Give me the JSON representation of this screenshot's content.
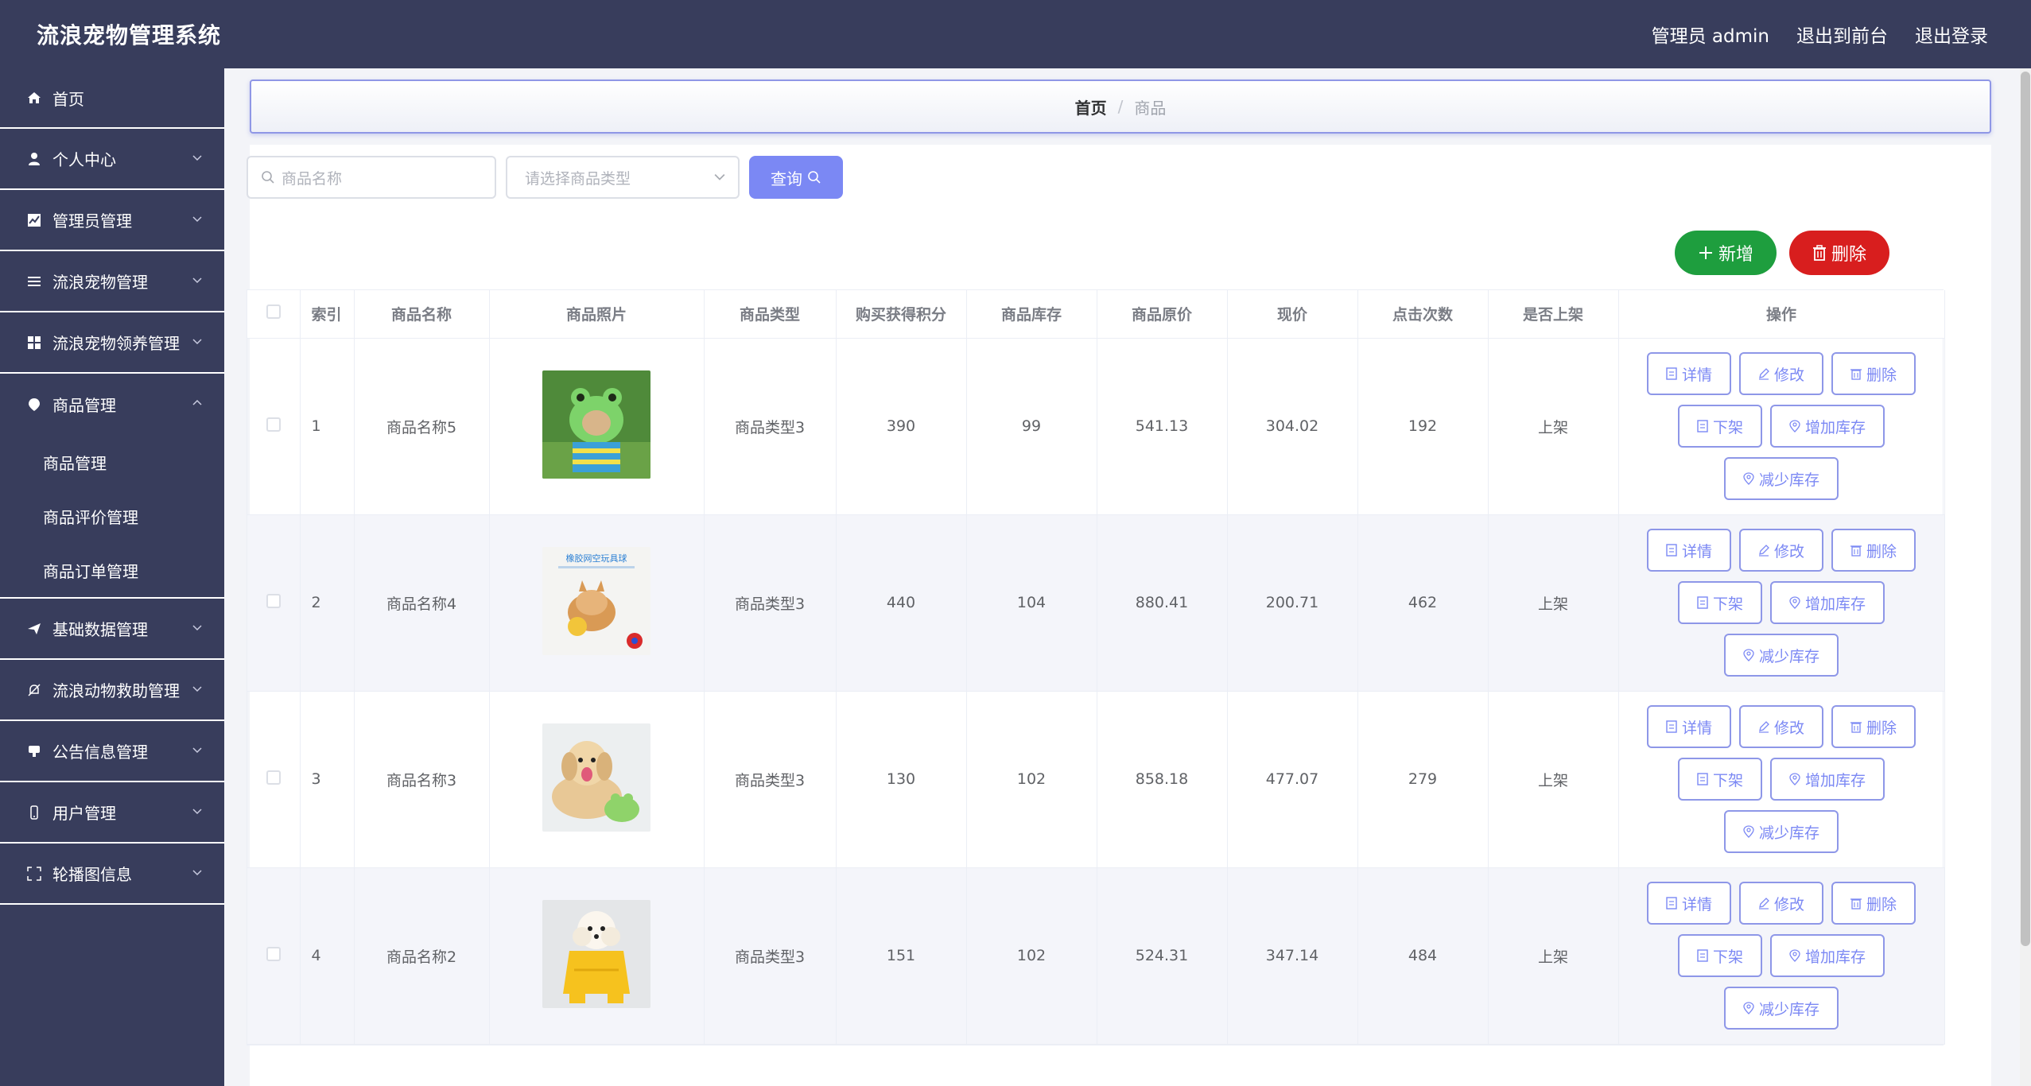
{
  "app": {
    "title": "流浪宠物管理系统"
  },
  "header": {
    "user": "管理员 admin",
    "front_link": "退出到前台",
    "logout": "退出登录"
  },
  "sidebar": {
    "items": [
      {
        "label": "首页",
        "icon": "home-icon"
      },
      {
        "label": "个人中心",
        "icon": "user-icon"
      },
      {
        "label": "管理员管理",
        "icon": "chart-icon"
      },
      {
        "label": "流浪宠物管理",
        "icon": "list-icon"
      },
      {
        "label": "流浪宠物领养管理",
        "icon": "grid-icon"
      },
      {
        "label": "商品管理",
        "icon": "tag-icon",
        "expanded": true,
        "children": [
          "商品管理",
          "商品评价管理",
          "商品订单管理"
        ]
      },
      {
        "label": "基础数据管理",
        "icon": "send-icon"
      },
      {
        "label": "流浪动物救助管理",
        "icon": "bell-off-icon"
      },
      {
        "label": "公告信息管理",
        "icon": "message-icon"
      },
      {
        "label": "用户管理",
        "icon": "phone-icon"
      },
      {
        "label": "轮播图信息",
        "icon": "fullscreen-icon"
      }
    ]
  },
  "breadcrumb": {
    "home": "首页",
    "sep": "/",
    "current": "商品"
  },
  "search": {
    "name_placeholder": "商品名称",
    "type_placeholder": "请选择商品类型",
    "query_label": "查询"
  },
  "actions": {
    "add_label": "新增",
    "delete_label": "删除"
  },
  "table": {
    "columns": [
      "索引",
      "商品名称",
      "商品照片",
      "商品类型",
      "购买获得积分",
      "商品库存",
      "商品原价",
      "现价",
      "点击次数",
      "是否上架",
      "操作"
    ],
    "rows": [
      {
        "index": "1",
        "name": "商品名称5",
        "photo": "dog-frog-hat",
        "type": "商品类型3",
        "points": "390",
        "stock": "99",
        "orig_price": "541.13",
        "price": "304.02",
        "clicks": "192",
        "status": "上架"
      },
      {
        "index": "2",
        "name": "商品名称4",
        "photo": "shiba-ball-toy",
        "type": "商品类型3",
        "points": "440",
        "stock": "104",
        "orig_price": "880.41",
        "price": "200.71",
        "clicks": "462",
        "status": "上架"
      },
      {
        "index": "3",
        "name": "商品名称3",
        "photo": "golden-retriever",
        "type": "商品类型3",
        "points": "130",
        "stock": "102",
        "orig_price": "858.18",
        "price": "477.07",
        "clicks": "279",
        "status": "上架"
      },
      {
        "index": "4",
        "name": "商品名称2",
        "photo": "poodle-raincoat",
        "type": "商品类型3",
        "points": "151",
        "stock": "102",
        "orig_price": "524.31",
        "price": "347.14",
        "clicks": "484",
        "status": "上架"
      }
    ],
    "row_actions": {
      "detail": "详情",
      "edit": "修改",
      "delete": "删除",
      "off_shelf": "下架",
      "add_stock": "增加库存",
      "reduce_stock": "减少库存"
    },
    "thumb_overlay_text": "橡胶网空玩具球"
  },
  "colors": {
    "nav_bg": "#383d5c",
    "accent": "#7b88f4",
    "add": "#1e9e3e",
    "danger": "#d81e1e"
  }
}
